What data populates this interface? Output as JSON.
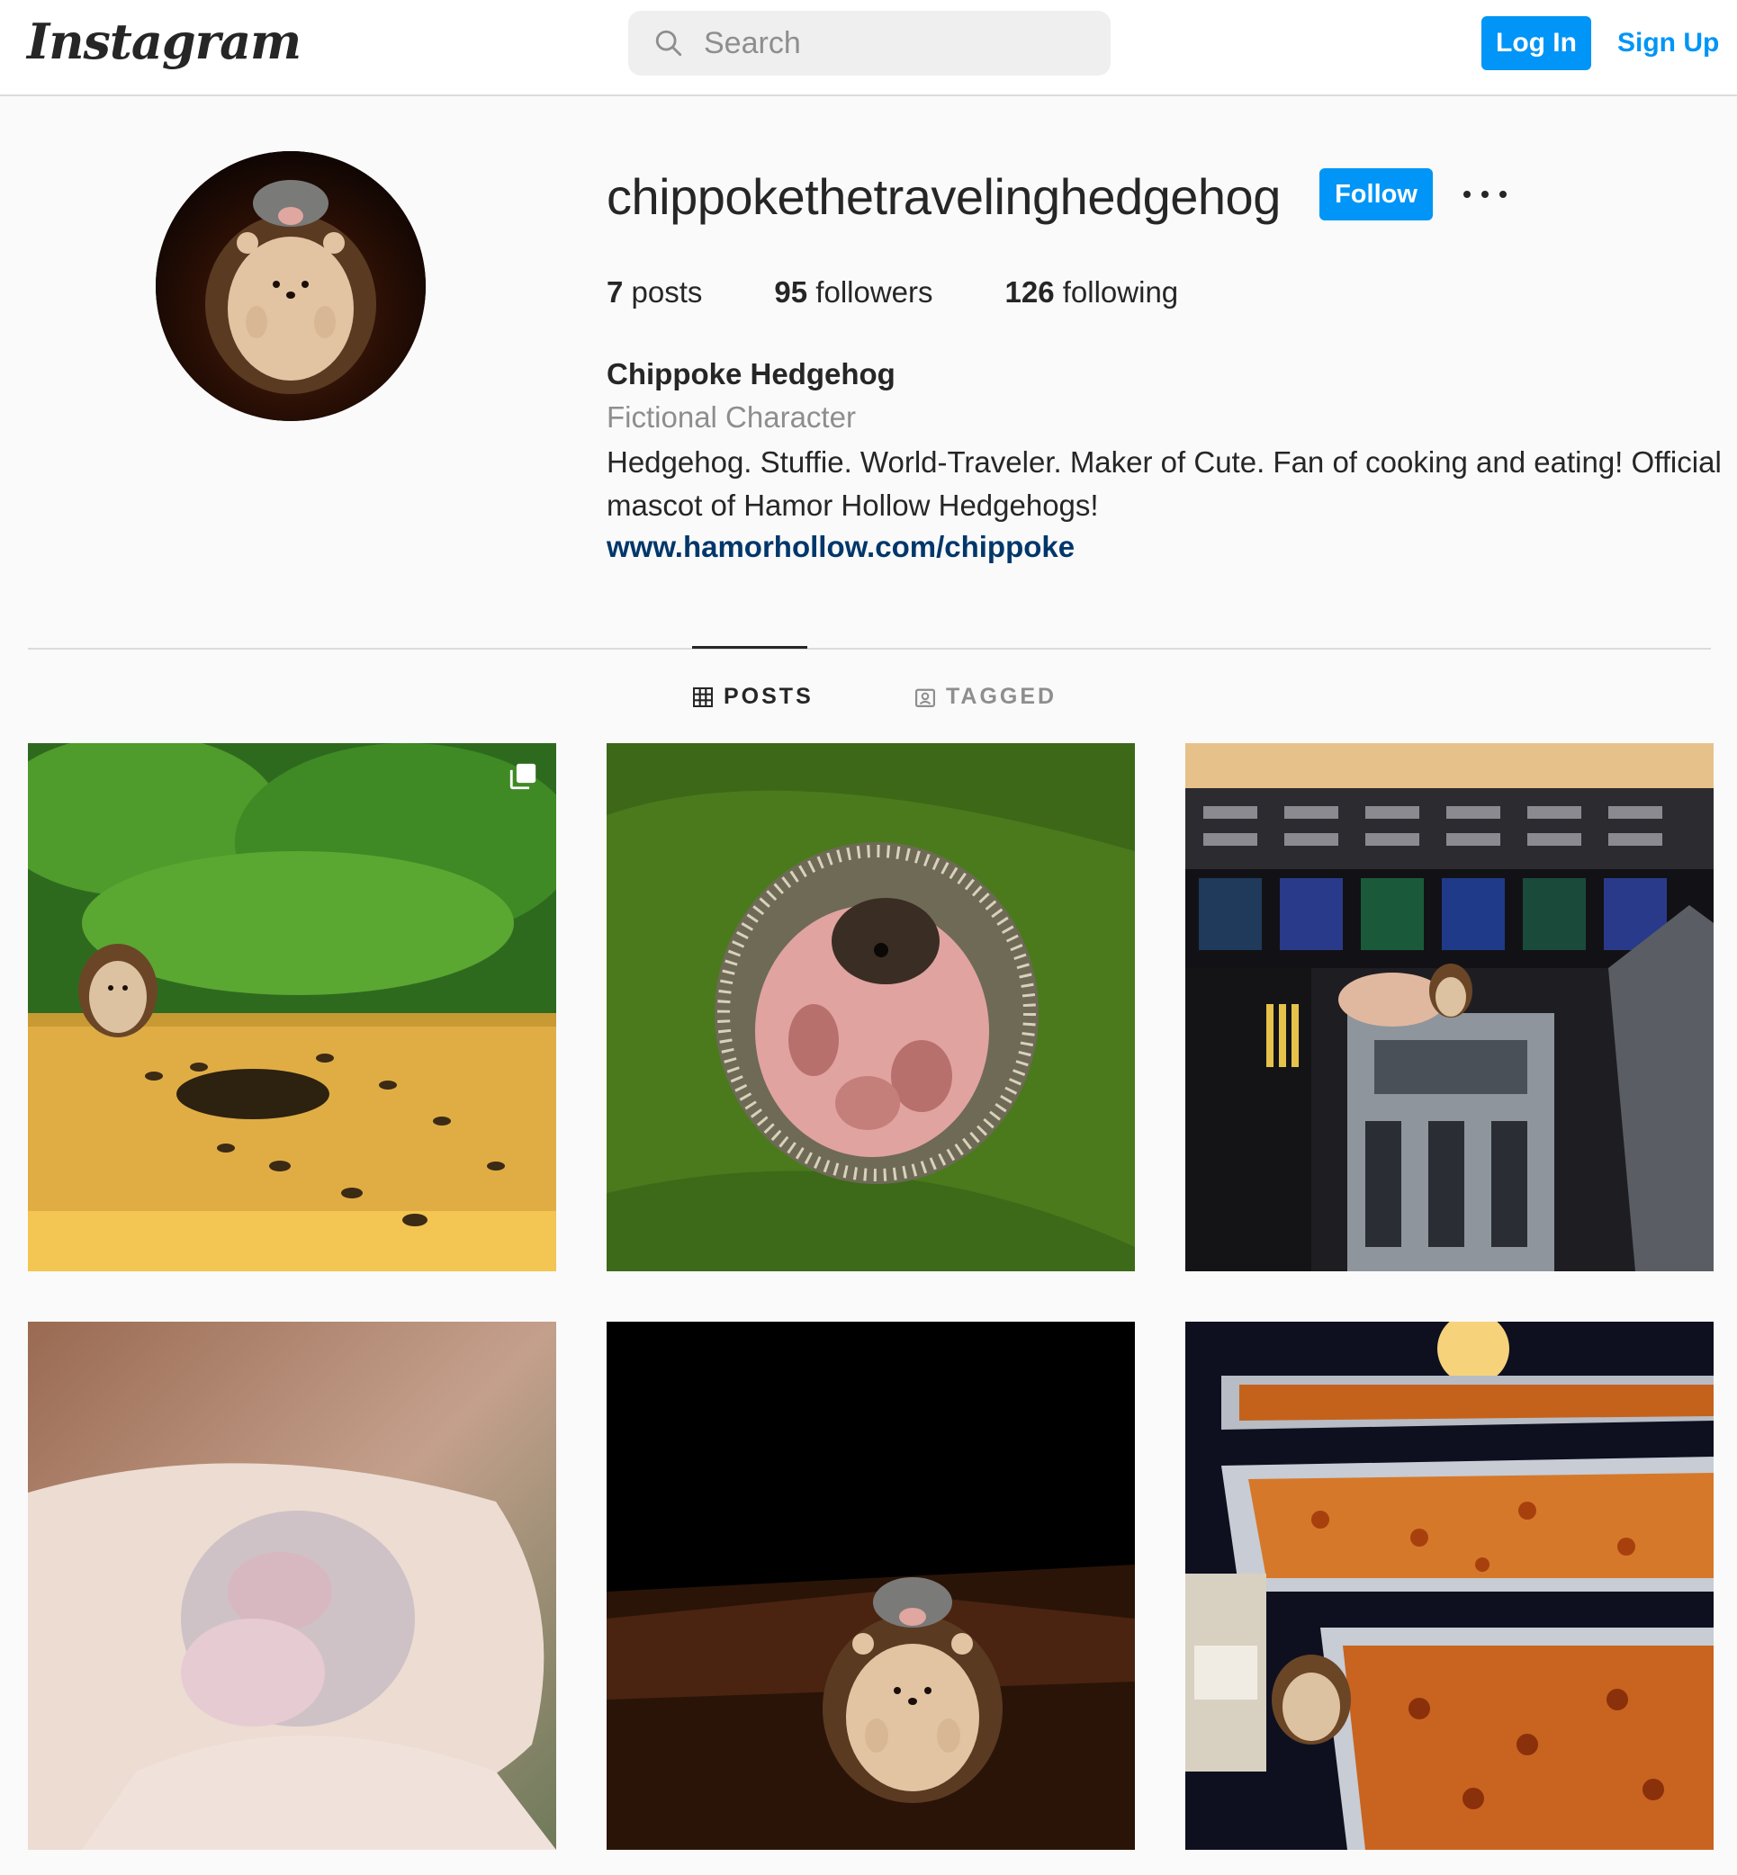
{
  "header": {
    "logo": "Instagram",
    "search_placeholder": "Search",
    "login_label": "Log In",
    "signup_label": "Sign Up"
  },
  "profile": {
    "username": "chippokethetravelinghedgehog",
    "follow_label": "Follow",
    "stats": [
      {
        "value": "7",
        "label": "posts"
      },
      {
        "value": "95",
        "label": "followers"
      },
      {
        "value": "126",
        "label": "following"
      }
    ],
    "full_name": "Chippoke Hedgehog",
    "category": "Fictional Character",
    "bio": "Hedgehog. Stuffie. World-Traveler. Maker of Cute. Fan of cooking and eating! Official mascot of Hamor Hollow Hedgehogs!",
    "website": "www.hamorhollow.com/chippoke"
  },
  "tabs": [
    {
      "label": "POSTS",
      "active": true
    },
    {
      "label": "TAGGED",
      "active": false
    }
  ],
  "posts": [
    {
      "subject": "plush hedgehog beside beehive with bees",
      "multi": true
    },
    {
      "subject": "baby hedgehog curled on green blanket",
      "multi": false
    },
    {
      "subject": "hand holding plush hedgehog in airplane cockpit",
      "multi": false
    },
    {
      "subject": "newborn hoglet in palm of hand",
      "multi": false
    },
    {
      "subject": "plush hedgehog on dark wooden surface",
      "multi": false
    },
    {
      "subject": "plush hedgehog by oven trays of snack mix",
      "multi": false
    }
  ],
  "colors": {
    "brand_blue": "#0095f6",
    "link_blue": "#00376b",
    "text": "#262626",
    "muted": "#8e8e8e",
    "border": "#dbdbdb"
  }
}
